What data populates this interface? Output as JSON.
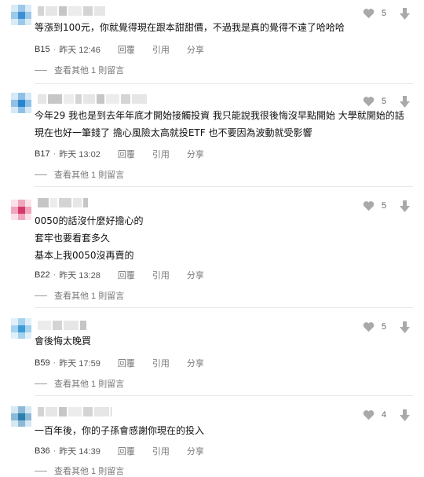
{
  "comments": [
    {
      "likes": "5",
      "text": "等漲到100元，你就覺得現在跟本甜甜價，不過我是真的覺得不遠了哈哈哈",
      "floor": "B15",
      "time": "昨天 12:46",
      "actions": [
        "回覆",
        "引用",
        "分享"
      ],
      "replies": "查看其他 1 則留言",
      "avatar_colors": [
        "#3b8fd4",
        "#9cc8ea",
        "#d9ebf7"
      ]
    },
    {
      "likes": "5",
      "text": "今年29 我也是到去年年底才開始接觸投資 我只能說我很後悔沒早點開始 大學就開始的話現在也好一筆錢了 擔心風險太高就投ETF 也不要因為波動就受影響",
      "floor": "B17",
      "time": "昨天 13:02",
      "actions": [
        "回覆",
        "引用",
        "分享"
      ],
      "replies": "查看其他 1 則留言",
      "avatar_colors": [
        "#2a85cf",
        "#8fc1e7",
        "#d5e9f7"
      ]
    },
    {
      "likes": "5",
      "text": "0050的話沒什麼好擔心的\n套牢也要看套多久\n基本上我0050沒再賣的",
      "floor": "B22",
      "time": "昨天 13:28",
      "actions": [
        "回覆",
        "引用",
        "分享"
      ],
      "replies": "查看其他 1 則留言",
      "avatar_colors": [
        "#d63a6a",
        "#f0a6bd",
        "#fbe2ea"
      ]
    },
    {
      "likes": "5",
      "text": "會後悔太晚買",
      "floor": "B59",
      "time": "昨天 17:59",
      "actions": [
        "回覆",
        "引用",
        "分享"
      ],
      "replies": "查看其他 1 則留言",
      "avatar_colors": [
        "#3c9bd6",
        "#a5d2ee",
        "#e0f0fa"
      ]
    },
    {
      "likes": "4",
      "text": "一百年後，你的子孫會感謝你現在的投入",
      "floor": "B36",
      "time": "昨天 14:39",
      "actions": [
        "回覆",
        "引用",
        "分享"
      ],
      "replies": "查看其他 1 則留言",
      "avatar_colors": [
        "#2c7fae",
        "#8cbad6",
        "#d6e8f2"
      ]
    }
  ],
  "colors": {
    "icon": "#a9a9a9",
    "text": "#111111",
    "meta": "#777777"
  }
}
